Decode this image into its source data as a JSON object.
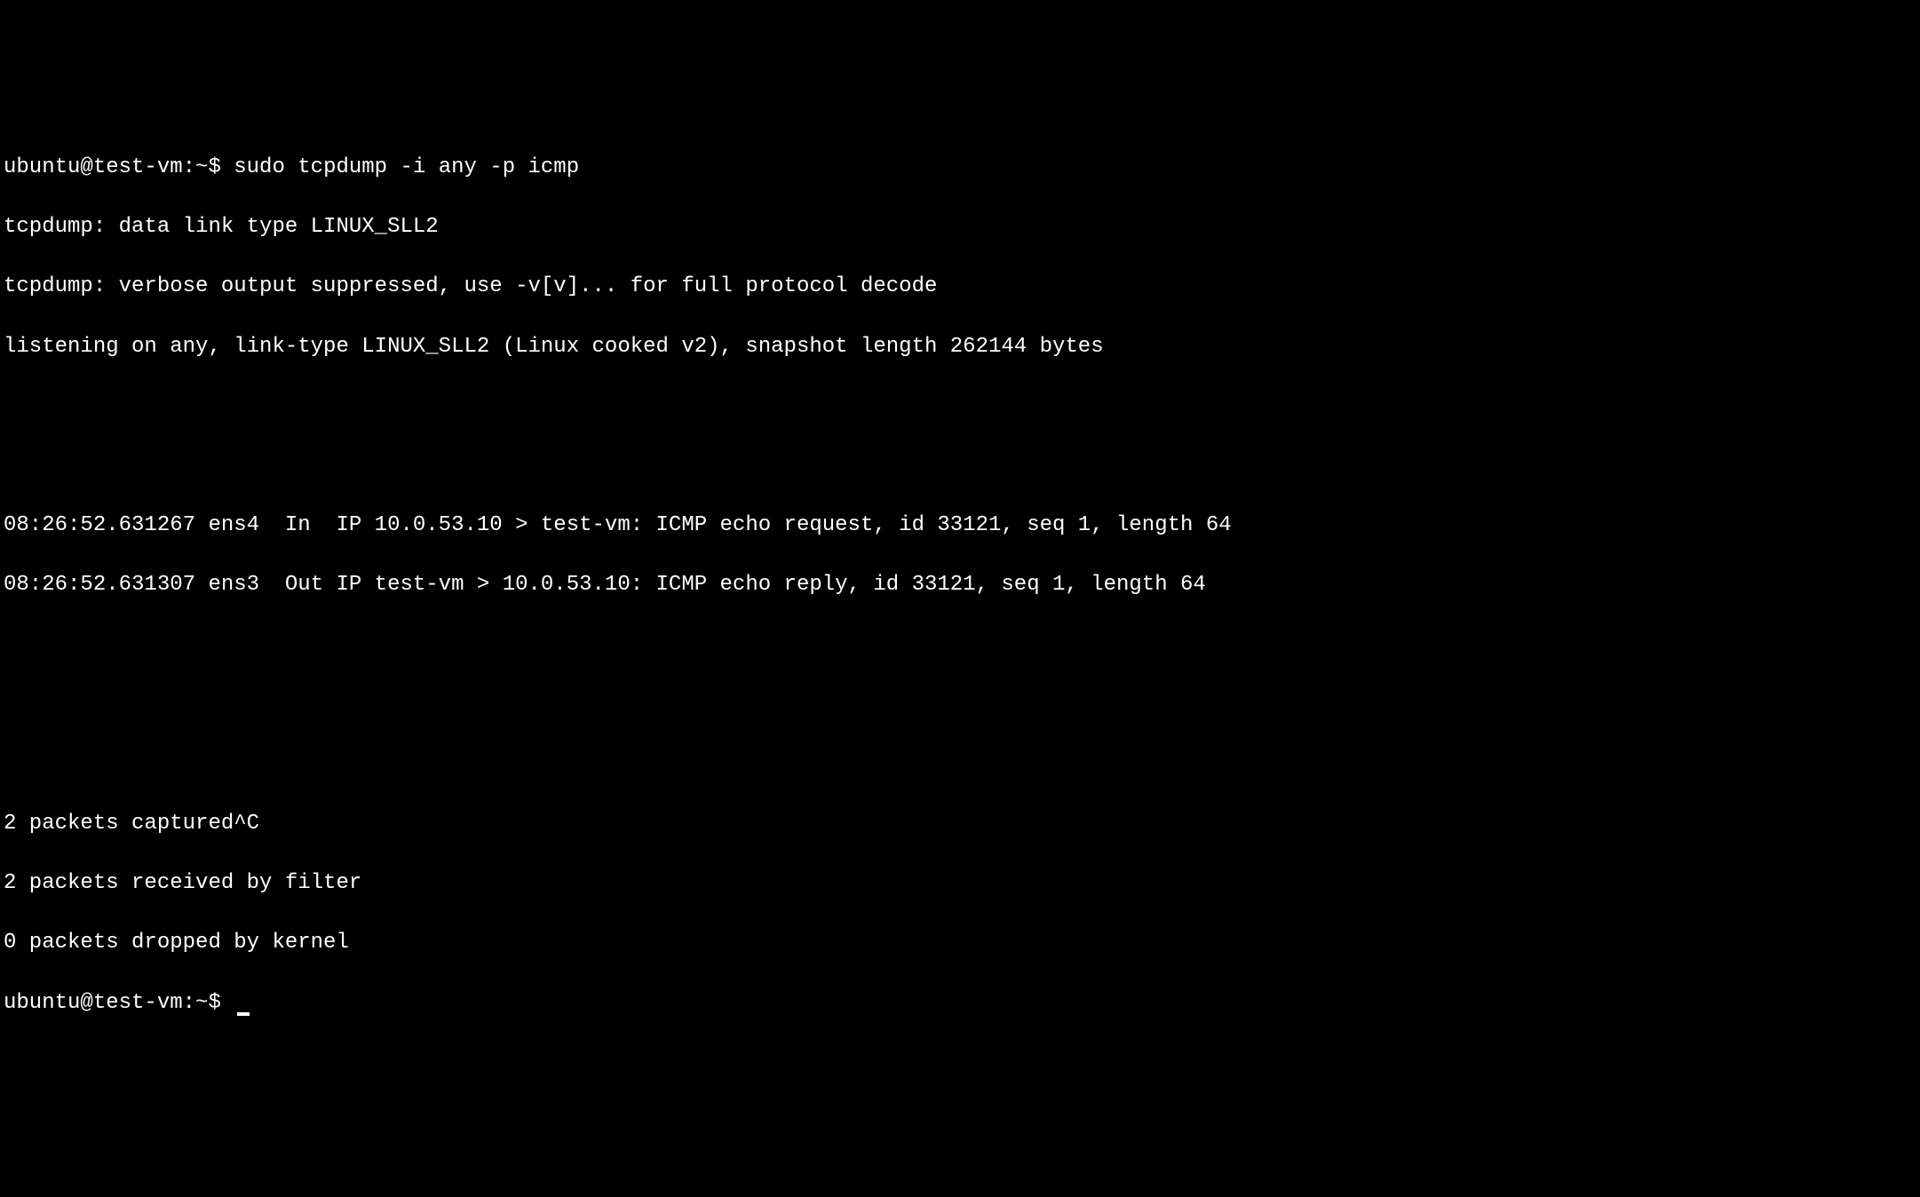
{
  "prompt1": {
    "user_host": "ubuntu@test-vm:~$",
    "command": "sudo tcpdump -i any -p icmp"
  },
  "output": {
    "line1": "tcpdump: data link type LINUX_SLL2",
    "line2": "tcpdump: verbose output suppressed, use -v[v]... for full protocol decode",
    "line3": "listening on any, link-type LINUX_SLL2 (Linux cooked v2), snapshot length 262144 bytes",
    "packet1": "08:26:52.631267 ens4  In  IP 10.0.53.10 > test-vm: ICMP echo request, id 33121, seq 1, length 64",
    "packet2": "08:26:52.631307 ens3  Out IP test-vm > 10.0.53.10: ICMP echo reply, id 33121, seq 1, length 64",
    "summary1": "2 packets captured^C",
    "summary2": "2 packets received by filter",
    "summary3": "0 packets dropped by kernel"
  },
  "prompt2": {
    "user_host": "ubuntu@test-vm:~$"
  }
}
